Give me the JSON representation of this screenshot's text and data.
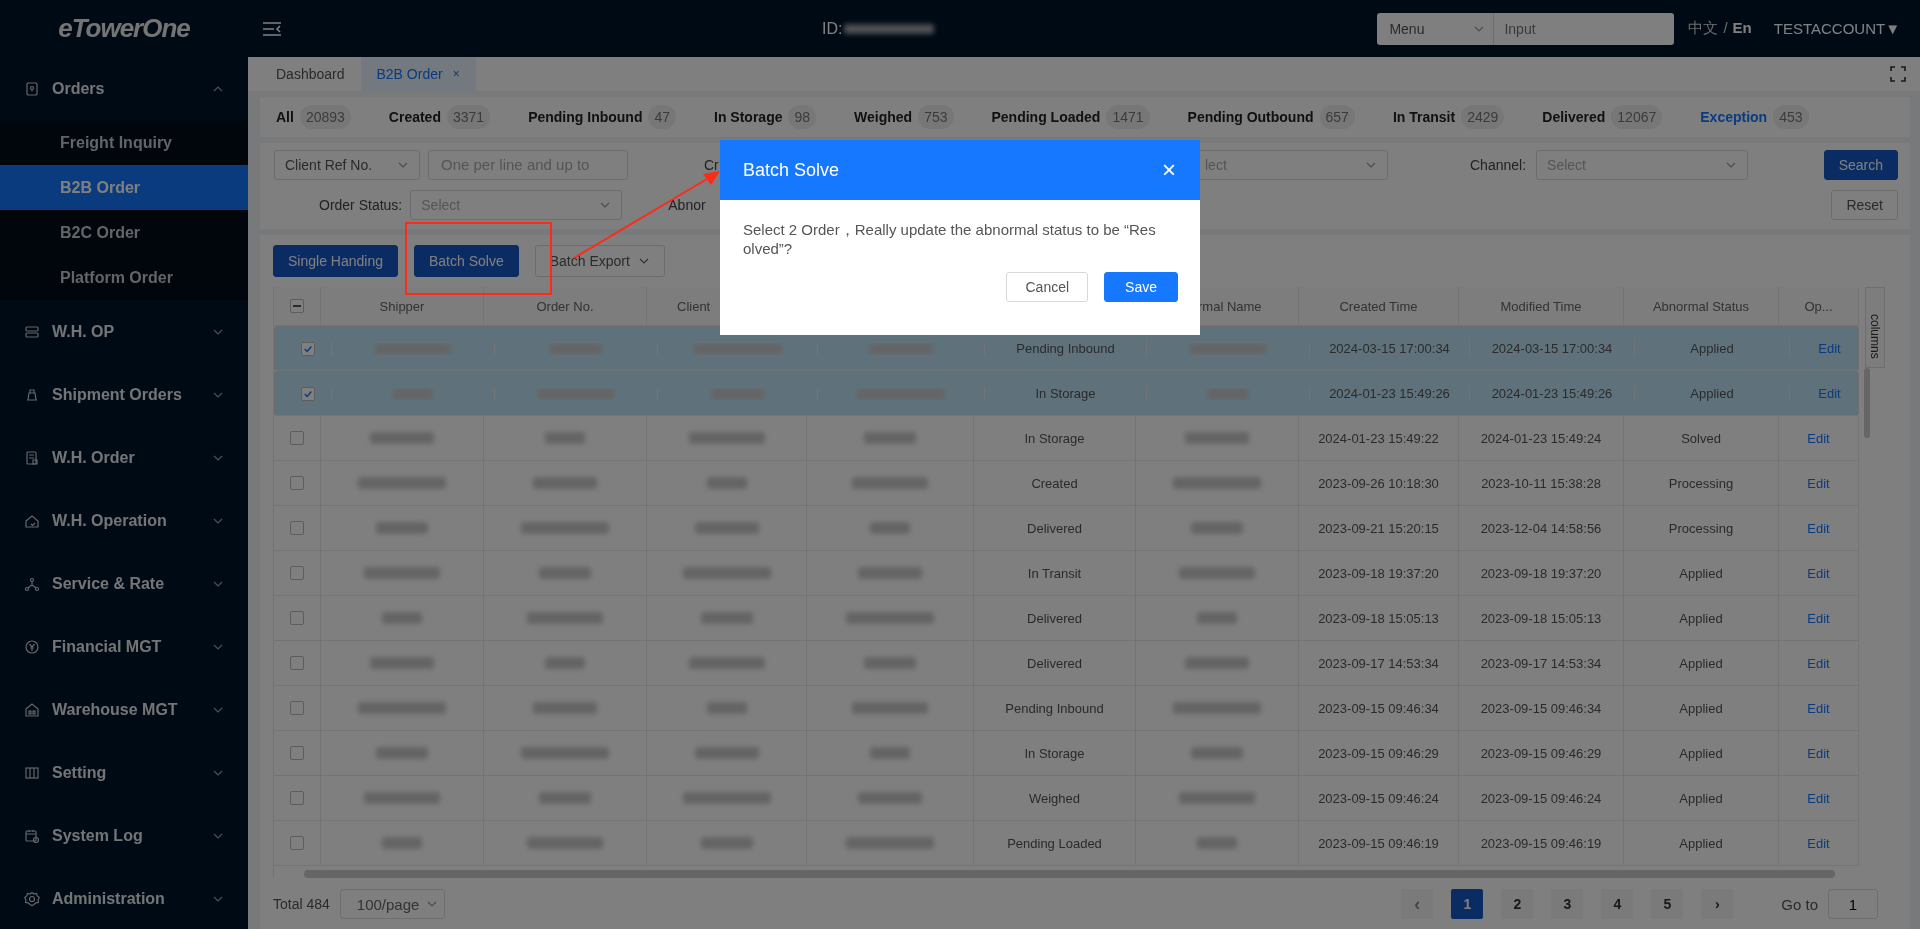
{
  "logo": "eTowerOne",
  "topbar": {
    "id_label": "ID:",
    "menu_select": "Menu",
    "search_placeholder": "Input",
    "languages": [
      {
        "label": "中文",
        "selected": false
      },
      {
        "label": "En",
        "selected": true
      }
    ],
    "language_separator": "/",
    "account": "TESTACCOUNT▼"
  },
  "sidebar": {
    "items": [
      {
        "label": "Orders",
        "expanded": true,
        "children": [
          {
            "label": "Freight Inquiry",
            "selected": false
          },
          {
            "label": "B2B Order",
            "selected": true
          },
          {
            "label": "B2C Order",
            "selected": false
          },
          {
            "label": "Platform Order",
            "selected": false
          }
        ]
      },
      {
        "label": "W.H. OP",
        "expanded": false
      },
      {
        "label": "Shipment Orders",
        "expanded": false
      },
      {
        "label": "W.H. Order",
        "expanded": false
      },
      {
        "label": "W.H. Operation",
        "expanded": false
      },
      {
        "label": "Service & Rate",
        "expanded": false
      },
      {
        "label": "Financial MGT",
        "expanded": false
      },
      {
        "label": "Warehouse MGT",
        "expanded": false
      },
      {
        "label": "Setting",
        "expanded": false
      },
      {
        "label": "System Log",
        "expanded": false
      },
      {
        "label": "Administration",
        "expanded": false
      }
    ]
  },
  "page_tabs": [
    {
      "label": "Dashboard",
      "selected": false,
      "closable": false
    },
    {
      "label": "B2B Order",
      "selected": true,
      "closable": true,
      "close": "×"
    }
  ],
  "status_tabs": [
    {
      "label": "All",
      "count": "20893",
      "selected": false
    },
    {
      "label": "Created",
      "count": "3371",
      "selected": false
    },
    {
      "label": "Pending Inbound",
      "count": "47",
      "selected": false
    },
    {
      "label": "In Storage",
      "count": "98",
      "selected": false
    },
    {
      "label": "Weighed",
      "count": "753",
      "selected": false
    },
    {
      "label": "Pending Loaded",
      "count": "1471",
      "selected": false
    },
    {
      "label": "Pending Outbound",
      "count": "657",
      "selected": false
    },
    {
      "label": "In Transit",
      "count": "2429",
      "selected": false
    },
    {
      "label": "Delivered",
      "count": "12067",
      "selected": false
    },
    {
      "label": "Exception",
      "count": "453",
      "selected": true
    }
  ],
  "filters": {
    "ref_select": "Client Ref No.",
    "ref_placeholder": "One per line and up to",
    "label_cut_1": "Cr",
    "select_cut": "lect",
    "channel_label": "Channel:",
    "channel_placeholder": "Select",
    "order_status_label": "Order Status:",
    "order_status_placeholder": "Select",
    "label_cut_2": "Abnor",
    "search": "Search",
    "reset": "Reset"
  },
  "actions": [
    "Single Handing",
    "Batch Solve",
    "Batch Export"
  ],
  "table": {
    "columns": [
      "Shipper",
      "Order No.",
      "Client",
      "rmal Name",
      "Created Time",
      "Modified Time",
      "Abnormal Status",
      "Op..."
    ],
    "side_tab": "columns",
    "select_all_indeterminate": true,
    "rows": [
      {
        "checked": true,
        "status": "Pending Inbound",
        "created": "2024-03-15 17:00:34",
        "modified": "2024-03-15 17:00:34",
        "abnormal": "Applied",
        "op": "Edit"
      },
      {
        "checked": true,
        "status": "In Storage",
        "created": "2024-01-23 15:49:26",
        "modified": "2024-01-23 15:49:26",
        "abnormal": "Applied",
        "op": "Edit"
      },
      {
        "checked": false,
        "status": "In Storage",
        "created": "2024-01-23 15:49:22",
        "modified": "2024-01-23 15:49:24",
        "abnormal": "Solved",
        "op": "Edit"
      },
      {
        "checked": false,
        "status": "Created",
        "created": "2023-09-26 10:18:30",
        "modified": "2023-10-11 15:38:28",
        "abnormal": "Processing",
        "op": "Edit"
      },
      {
        "checked": false,
        "status": "Delivered",
        "created": "2023-09-21 15:20:15",
        "modified": "2023-12-04 14:58:56",
        "abnormal": "Processing",
        "op": "Edit"
      },
      {
        "checked": false,
        "status": "In Transit",
        "created": "2023-09-18 19:37:20",
        "modified": "2023-09-18 19:37:20",
        "abnormal": "Applied",
        "op": "Edit"
      },
      {
        "checked": false,
        "status": "Delivered",
        "created": "2023-09-18 15:05:13",
        "modified": "2023-09-18 15:05:13",
        "abnormal": "Applied",
        "op": "Edit"
      },
      {
        "checked": false,
        "status": "Delivered",
        "created": "2023-09-17 14:53:34",
        "modified": "2023-09-17 14:53:34",
        "abnormal": "Applied",
        "op": "Edit"
      },
      {
        "checked": false,
        "status": "Pending Inbound",
        "created": "2023-09-15 09:46:34",
        "modified": "2023-09-15 09:46:34",
        "abnormal": "Applied",
        "op": "Edit"
      },
      {
        "checked": false,
        "status": "In Storage",
        "created": "2023-09-15 09:46:29",
        "modified": "2023-09-15 09:46:29",
        "abnormal": "Applied",
        "op": "Edit"
      },
      {
        "checked": false,
        "status": "Weighed",
        "created": "2023-09-15 09:46:24",
        "modified": "2023-09-15 09:46:24",
        "abnormal": "Applied",
        "op": "Edit"
      },
      {
        "checked": false,
        "status": "Pending Loaded",
        "created": "2023-09-15 09:46:19",
        "modified": "2023-09-15 09:46:19",
        "abnormal": "Applied",
        "op": "Edit"
      }
    ]
  },
  "pagination": {
    "total": "Total 484",
    "page_size": "100/page",
    "prev": "‹",
    "pages": [
      {
        "label": "1",
        "selected": true
      },
      {
        "label": "2",
        "selected": false
      },
      {
        "label": "3",
        "selected": false
      },
      {
        "label": "4",
        "selected": false
      },
      {
        "label": "5",
        "selected": false
      }
    ],
    "next": "›",
    "goto_label": "Go to",
    "goto_value": "1"
  },
  "dialog": {
    "title": "Batch Solve",
    "close": "×",
    "message": "Select 2 Order，Really update the abnormal status to be “Resolved”?",
    "cancel": "Cancel",
    "save": "Save"
  }
}
